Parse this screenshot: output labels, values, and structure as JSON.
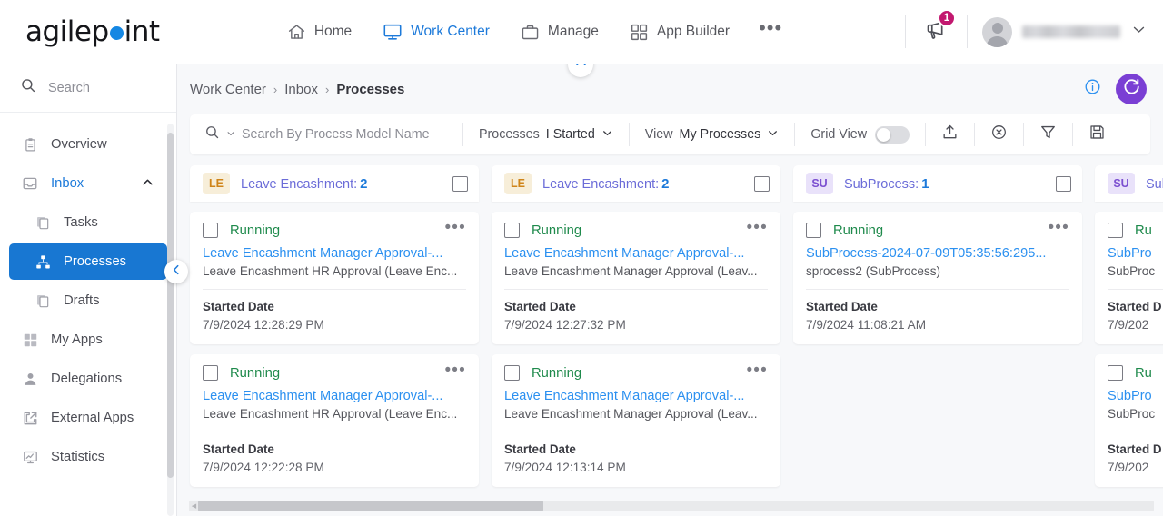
{
  "header": {
    "logo_text_a": "agilep",
    "logo_text_b": "int",
    "nav": [
      {
        "label": "Home",
        "icon": "home-icon",
        "active": false
      },
      {
        "label": "Work Center",
        "icon": "monitor-icon",
        "active": true
      },
      {
        "label": "Manage",
        "icon": "briefcase-icon",
        "active": false
      },
      {
        "label": "App Builder",
        "icon": "grid-icon",
        "active": false
      }
    ],
    "more_label": "•••",
    "notification_icon": "announcement-icon",
    "notification_count": "1",
    "user_name": "",
    "user_chevron_icon": "chevron-down-icon"
  },
  "sidebar": {
    "search_placeholder": "Search",
    "search_icon": "search-icon",
    "items": [
      {
        "label": "Overview",
        "icon": "clipboard-icon",
        "level": 0,
        "active": false,
        "expandable": false
      },
      {
        "label": "Inbox",
        "icon": "inbox-icon",
        "level": 0,
        "active": false,
        "expandable": true,
        "highlight": true
      },
      {
        "label": "Tasks",
        "icon": "tasks-icon",
        "level": 1,
        "active": false,
        "expandable": false
      },
      {
        "label": "Processes",
        "icon": "processes-icon",
        "level": 1,
        "active": true,
        "expandable": false
      },
      {
        "label": "Drafts",
        "icon": "drafts-icon",
        "level": 1,
        "active": false,
        "expandable": false
      },
      {
        "label": "My Apps",
        "icon": "apps-grid-icon",
        "level": 0,
        "active": false,
        "expandable": false
      },
      {
        "label": "Delegations",
        "icon": "person-icon",
        "level": 0,
        "active": false,
        "expandable": false
      },
      {
        "label": "External Apps",
        "icon": "external-link-icon",
        "level": 0,
        "active": false,
        "expandable": false
      },
      {
        "label": "Statistics",
        "icon": "chart-icon",
        "level": 0,
        "active": false,
        "expandable": false
      }
    ],
    "collapse_icon": "chevron-left-icon"
  },
  "breadcrumb": {
    "items": [
      "Work Center",
      "Inbox",
      "Processes"
    ],
    "separator": "›",
    "info_icon": "info-icon",
    "refresh_icon": "refresh-icon",
    "collapse_top_icon": "chevron-up-icon"
  },
  "toolbar": {
    "search_icon": "search-icon",
    "search_placeholder": "Search By Process Model Name",
    "processes_label": "Processes",
    "processes_value": "I Started",
    "view_label": "View",
    "view_value": "My Processes",
    "grid_view_label": "Grid View",
    "grid_view_on": false,
    "icons": [
      {
        "name": "upload-icon"
      },
      {
        "name": "clear-filter-icon"
      },
      {
        "name": "filter-icon"
      },
      {
        "name": "save-icon"
      }
    ]
  },
  "board": {
    "columns": [
      {
        "tag": "LE",
        "tag_style": "le",
        "title": "Leave Encashment:",
        "count": "2",
        "cards": [
          {
            "status": "Running",
            "name": "Leave Encashment Manager Approval-...",
            "subtitle": "Leave Encashment HR Approval (Leave Enc...",
            "field_label": "Started Date",
            "field_value": "7/9/2024 12:28:29 PM"
          },
          {
            "status": "Running",
            "name": "Leave Encashment Manager Approval-...",
            "subtitle": "Leave Encashment HR Approval (Leave Enc...",
            "field_label": "Started Date",
            "field_value": "7/9/2024 12:22:28 PM"
          }
        ]
      },
      {
        "tag": "LE",
        "tag_style": "le",
        "title": "Leave Encashment:",
        "count": "2",
        "cards": [
          {
            "status": "Running",
            "name": "Leave Encashment Manager Approval-...",
            "subtitle": "Leave Encashment Manager Approval (Leav...",
            "field_label": "Started Date",
            "field_value": "7/9/2024 12:27:32 PM"
          },
          {
            "status": "Running",
            "name": "Leave Encashment Manager Approval-...",
            "subtitle": "Leave Encashment Manager Approval (Leav...",
            "field_label": "Started Date",
            "field_value": "7/9/2024 12:13:14 PM"
          }
        ]
      },
      {
        "tag": "SU",
        "tag_style": "su",
        "title": "SubProcess:",
        "count": "1",
        "cards": [
          {
            "status": "Running",
            "name": "SubProcess-2024-07-09T05:35:56:295...",
            "subtitle": "sprocess2 (SubProcess)",
            "field_label": "Started Date",
            "field_value": "7/9/2024 11:08:21 AM"
          }
        ]
      },
      {
        "tag": "SU",
        "tag_style": "su",
        "title": "Sub",
        "count": "",
        "cards": [
          {
            "status": "Ru",
            "name": "SubPro",
            "subtitle": "SubProc",
            "field_label": "Started D",
            "field_value": "7/9/202"
          },
          {
            "status": "Ru",
            "name": "SubPro",
            "subtitle": "SubProc",
            "field_label": "Started D",
            "field_value": "7/9/202"
          }
        ]
      }
    ]
  }
}
